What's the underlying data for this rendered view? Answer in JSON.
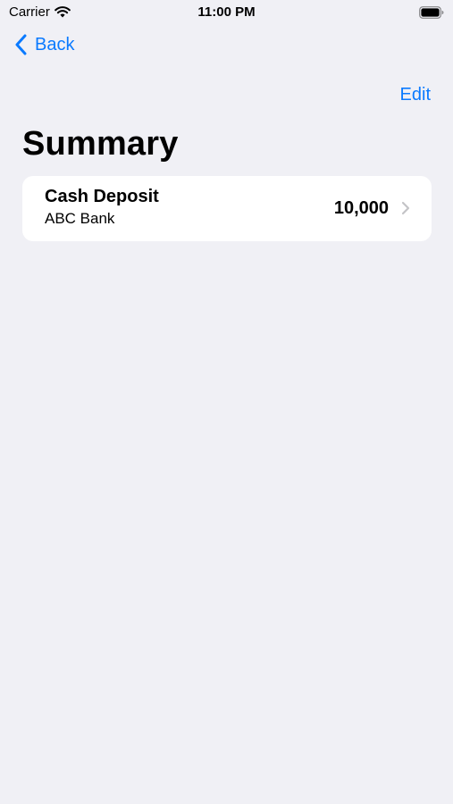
{
  "status_bar": {
    "carrier": "Carrier",
    "time": "11:00 PM",
    "icons": [
      "wifi-icon",
      "battery-icon"
    ]
  },
  "nav": {
    "back_label": "Back",
    "edit_label": "Edit",
    "icons": [
      "chevron-left-icon"
    ]
  },
  "page": {
    "title": "Summary"
  },
  "colors": {
    "accent": "#0a7aff",
    "background": "#f0f0f5",
    "card": "#ffffff",
    "chevron": "#c4c4c7"
  },
  "list": {
    "items": [
      {
        "title": "Cash Deposit",
        "subtitle": "ABC Bank",
        "amount": "10,000",
        "icon": "chevron-right-icon"
      }
    ]
  }
}
